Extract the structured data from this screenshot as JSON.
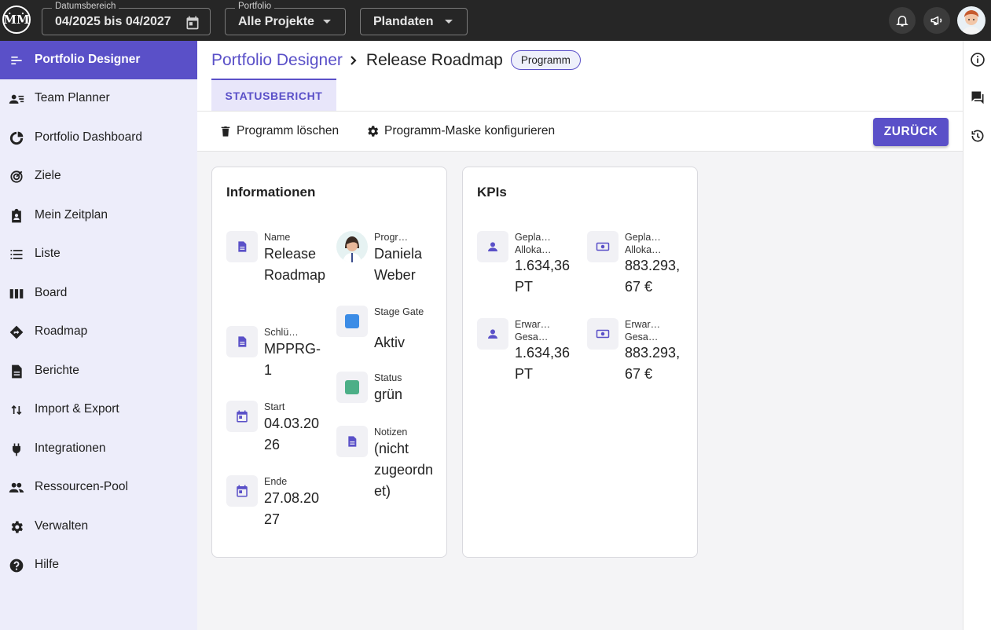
{
  "topbar": {
    "logo": "ṀṀ",
    "date_range": {
      "legend": "Datumsbereich",
      "value": "04/2025 bis 04/2027"
    },
    "portfolio": {
      "legend": "Portfolio",
      "value": "Alle Projekte"
    },
    "dataset": {
      "value": "Plandaten"
    }
  },
  "sidebar": {
    "items": [
      {
        "label": "Portfolio Designer",
        "icon": "designer-icon"
      },
      {
        "label": "Team Planner",
        "icon": "team-icon"
      },
      {
        "label": "Portfolio Dashboard",
        "icon": "dashboard-icon"
      },
      {
        "label": "Ziele",
        "icon": "target-icon"
      },
      {
        "label": "Mein Zeitplan",
        "icon": "schedule-icon"
      },
      {
        "label": "Liste",
        "icon": "list-icon"
      },
      {
        "label": "Board",
        "icon": "board-icon"
      },
      {
        "label": "Roadmap",
        "icon": "roadmap-icon"
      },
      {
        "label": "Berichte",
        "icon": "report-icon"
      },
      {
        "label": "Import & Export",
        "icon": "import-export-icon"
      },
      {
        "label": "Integrationen",
        "icon": "plug-icon"
      },
      {
        "label": "Ressourcen-Pool",
        "icon": "people-icon"
      },
      {
        "label": "Verwalten",
        "icon": "gear-icon"
      },
      {
        "label": "Hilfe",
        "icon": "help-icon"
      }
    ]
  },
  "header": {
    "crumb_root": "Portfolio Designer",
    "crumb_sep": "›",
    "title": "Release Roadmap",
    "chip": "Programm",
    "tab": "STATUSBERICHT"
  },
  "toolbar": {
    "delete": "Programm löschen",
    "configure": "Programm-Maske konfigurieren",
    "back": "ZURÜCK"
  },
  "info": {
    "title": "Informationen",
    "name": {
      "label": "Name",
      "value": "Release Roadmap"
    },
    "key": {
      "label": "Schlü…",
      "value": "MPPRG-1"
    },
    "start": {
      "label": "Start",
      "value": "04.03.2026"
    },
    "end": {
      "label": "Ende",
      "value": "27.08.2027"
    },
    "manager": {
      "label": "Progr…",
      "value": "Daniela Weber"
    },
    "stage": {
      "label": "Stage Gate",
      "value": "Aktiv",
      "color": "#3b8ce6"
    },
    "status": {
      "label": "Status",
      "value": "grün",
      "color": "#4caf87"
    },
    "notes": {
      "label": "Notizen",
      "value": "(nicht zugeordnet)"
    }
  },
  "kpis": {
    "title": "KPIs",
    "planned_alloc": {
      "label": "Gepla… Alloka…",
      "value": "1.634,36 PT"
    },
    "planned_alloc_cost": {
      "label": "Gepla… Alloka…",
      "value": "883.293,67 €"
    },
    "expected_total": {
      "label": "Erwar… Gesa…",
      "value": "1.634,36 PT"
    },
    "expected_total_cost": {
      "label": "Erwar… Gesa…",
      "value": "883.293,67 €"
    }
  },
  "colors": {
    "accent": "#5a50c8",
    "topbar": "#262626",
    "sidebar": "#ededfa"
  }
}
